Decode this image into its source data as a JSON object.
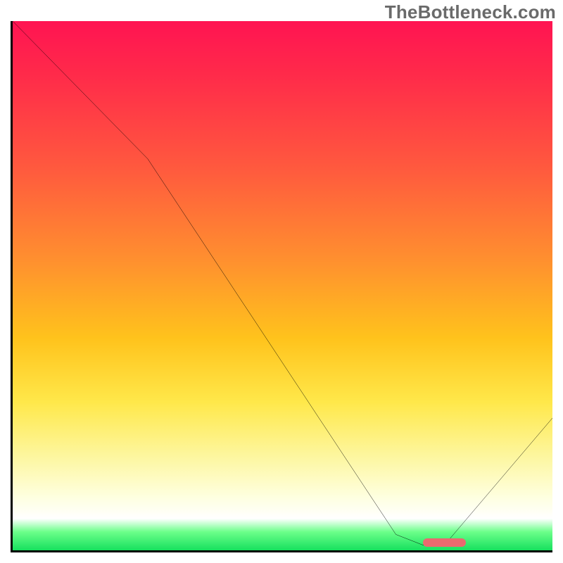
{
  "watermark": "TheBottleneck.com",
  "chart_data": {
    "type": "line",
    "title": "",
    "xlabel": "",
    "ylabel": "",
    "xlim": [
      0,
      100
    ],
    "ylim": [
      0,
      100
    ],
    "grid": false,
    "legend": false,
    "curve": {
      "x": [
        0,
        25,
        71,
        76,
        80,
        100
      ],
      "y": [
        100,
        74,
        3,
        1,
        1,
        25
      ]
    },
    "marker": {
      "x_start": 76,
      "x_end": 84,
      "y": 1.5,
      "color": "#e96a6f"
    },
    "gradient_stops": [
      {
        "pos": 0.0,
        "color": "#ff1452"
      },
      {
        "pos": 0.28,
        "color": "#ff5a3e"
      },
      {
        "pos": 0.6,
        "color": "#ffc31c"
      },
      {
        "pos": 0.82,
        "color": "#fdf69d"
      },
      {
        "pos": 0.94,
        "color": "#ffffff"
      },
      {
        "pos": 1.0,
        "color": "#16e05e"
      }
    ]
  }
}
